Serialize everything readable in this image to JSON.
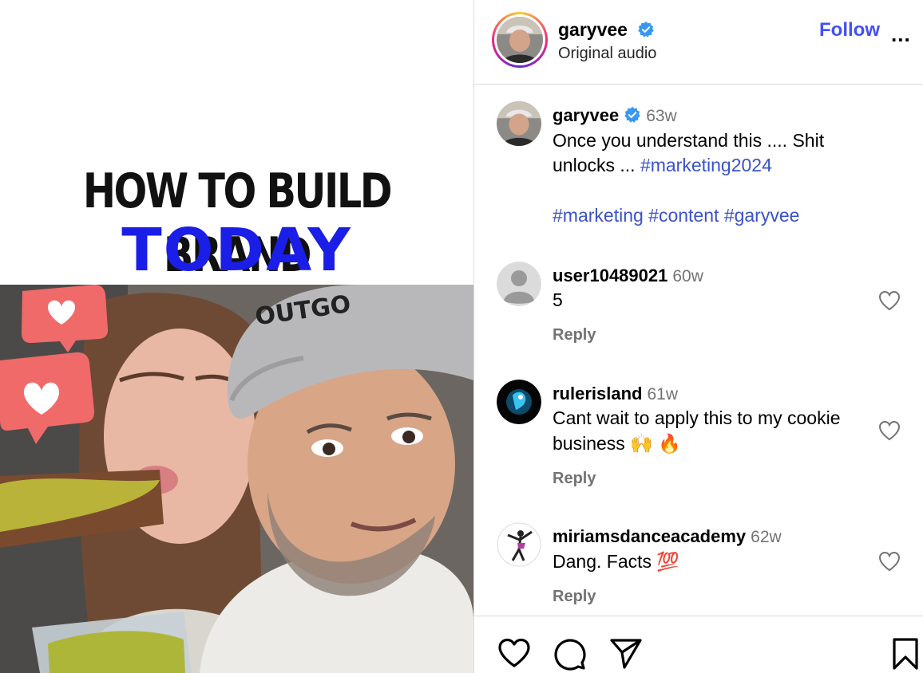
{
  "media": {
    "title_line1": "HOW TO BUILD BRAND",
    "title_line2": "TODAY",
    "cap_text": "OUTGO",
    "colors": {
      "title_dark": "#111111",
      "title_blue": "#1a1ee6",
      "heart_badge": "#f06a6a"
    }
  },
  "header": {
    "username": "garyvee",
    "subtitle": "Original audio",
    "follow_label": "Follow",
    "more_label": "..."
  },
  "caption": {
    "username": "garyvee",
    "time": "63w",
    "text_line1": "Once you understand this .... Shit",
    "text_line2_prefix": "unlocks ... ",
    "tag1": "#marketing2024",
    "tag2": "#marketing",
    "tag3": "#content",
    "tag4": "#garyvee"
  },
  "comments": [
    {
      "username": "user10489021",
      "time": "60w",
      "line1": "5",
      "line2": "",
      "reply_label": "Reply"
    },
    {
      "username": "rulerisland",
      "time": "61w",
      "line1": "Cant wait to apply this to my cookie",
      "line2": "business 🙌 🔥",
      "reply_label": "Reply"
    },
    {
      "username": "miriamsdanceacademy",
      "time": "62w",
      "line1": "Dang. Facts 💯",
      "line2": "",
      "reply_label": "Reply"
    }
  ],
  "icons": {
    "verified": "verified-badge-icon",
    "like": "heart-icon",
    "comment": "comment-icon",
    "share": "share-icon",
    "save": "bookmark-icon"
  },
  "colors": {
    "link": "#4150f7",
    "hashtag": "#3a52c9",
    "muted": "#737373",
    "border": "#dbdbdb"
  }
}
